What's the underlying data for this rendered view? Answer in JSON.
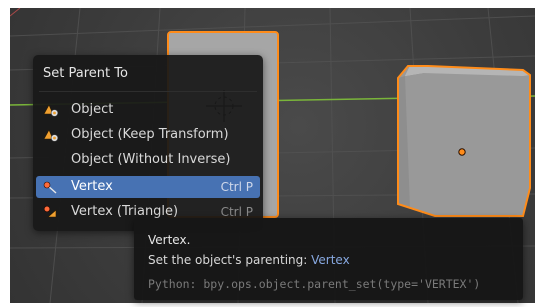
{
  "menu": {
    "title": "Set Parent To",
    "items": [
      {
        "label": "Object",
        "icon": "object-data-icon",
        "shortcut": "",
        "highlighted": false
      },
      {
        "label": "Object (Keep Transform)",
        "icon": "object-data-icon",
        "shortcut": "",
        "highlighted": false
      },
      {
        "label": "Object (Without Inverse)",
        "icon": "",
        "shortcut": "",
        "highlighted": false
      },
      {
        "label": "Vertex",
        "icon": "vertex-icon",
        "shortcut": "Ctrl P",
        "highlighted": true
      },
      {
        "label": "Vertex (Triangle)",
        "icon": "vertex-triangle-icon",
        "shortcut": "Ctrl P",
        "highlighted": false
      }
    ]
  },
  "tooltip": {
    "name": "Vertex.",
    "description_prefix": "Set the object's parenting: ",
    "description_value": "Vertex",
    "python": "Python: bpy.ops.object.parent_set(type='VERTEX')"
  },
  "colors": {
    "highlight": "#4772b3",
    "selection_outline": "#ff8c1a",
    "tooltip_value": "#87a8e0",
    "grid_x_axis": "#7ab53a"
  }
}
